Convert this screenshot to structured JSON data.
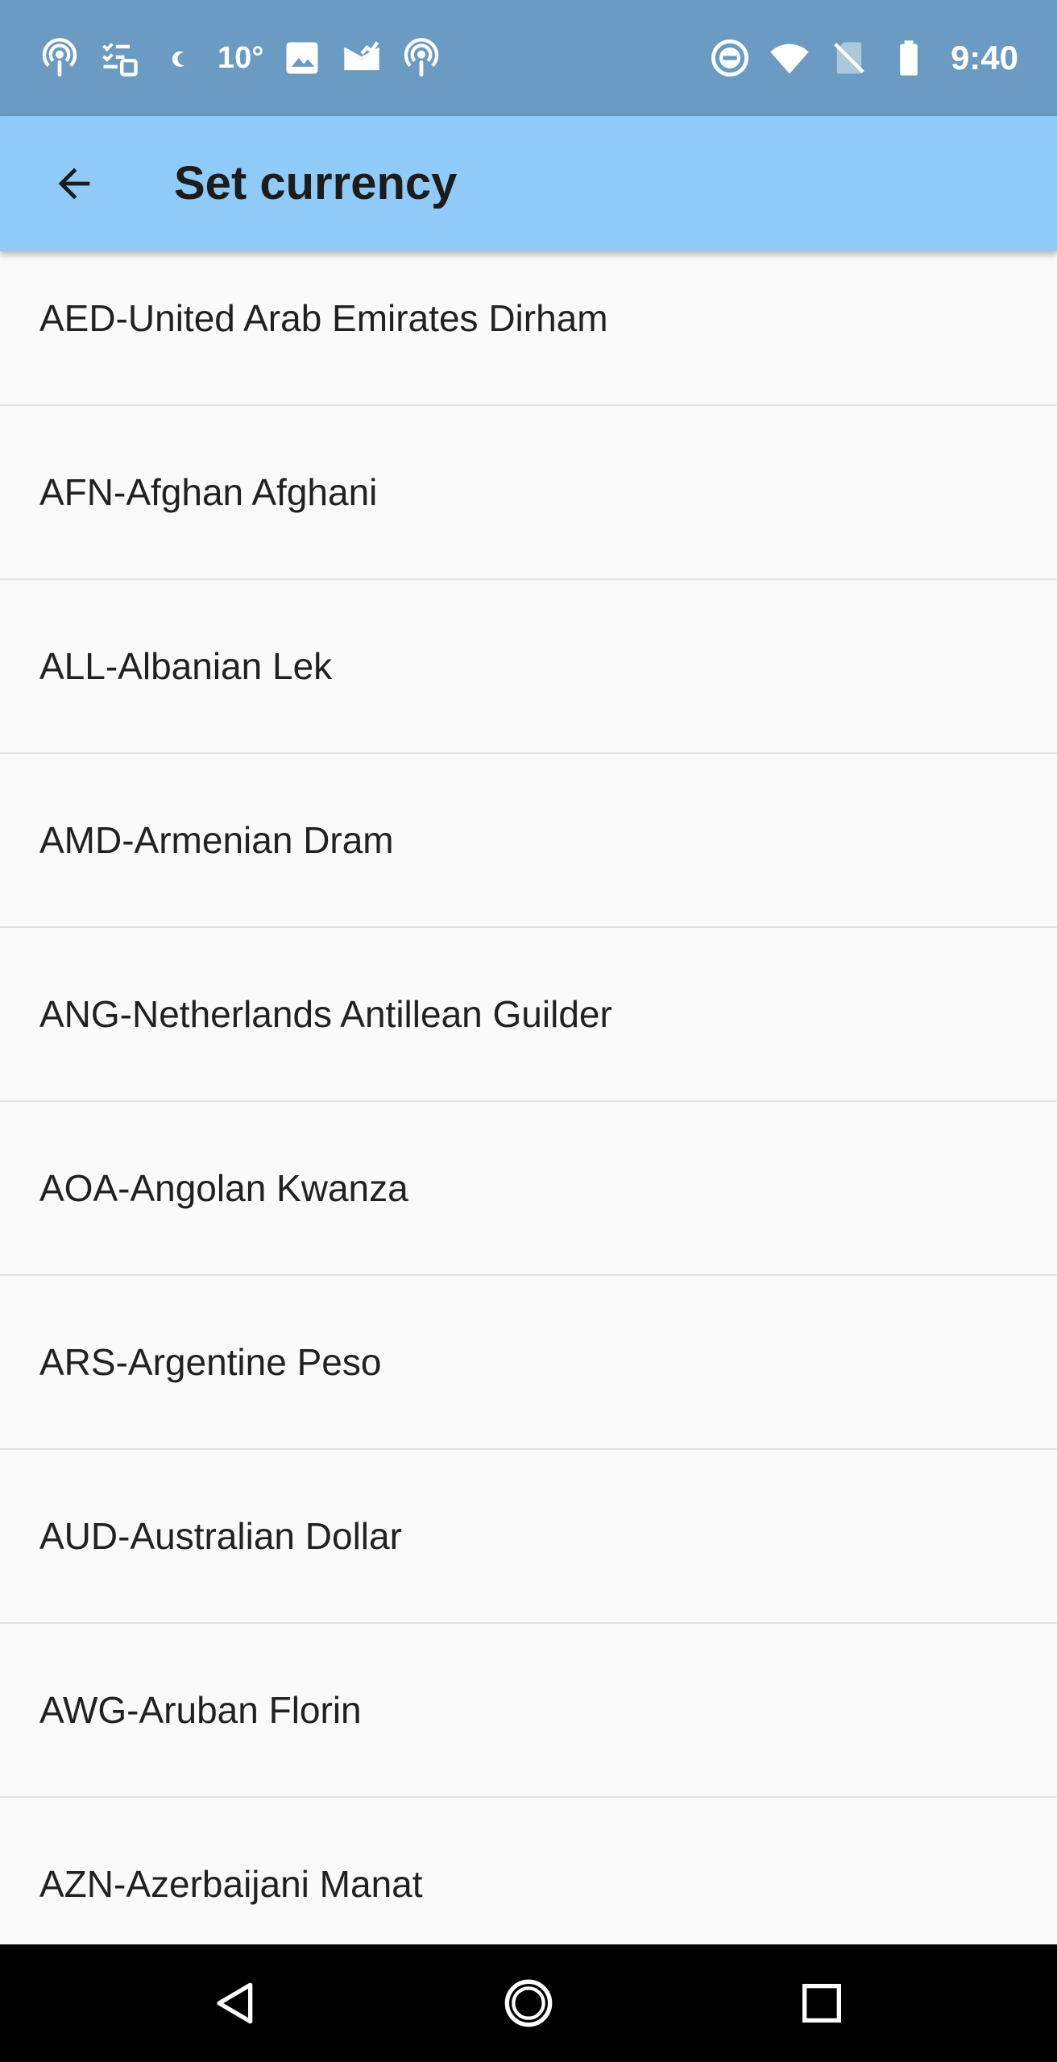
{
  "status_bar": {
    "temperature": "10°",
    "time": "9:40",
    "icons_left": [
      "podcast-icon",
      "tasks-icon",
      "moon-icon",
      "temperature",
      "image-icon",
      "mail-done-icon",
      "podcast-icon"
    ],
    "icons_right": [
      "dnd-icon",
      "wifi-icon",
      "no-sim-icon",
      "battery-icon"
    ],
    "background": "#6b9bc2"
  },
  "app_bar": {
    "title": "Set currency",
    "back_icon": "arrow-back-icon",
    "background": "#90caf9"
  },
  "currencies": [
    "AED-United Arab Emirates Dirham",
    "AFN-Afghan Afghani",
    "ALL-Albanian Lek",
    "AMD-Armenian Dram",
    "ANG-Netherlands Antillean Guilder",
    "AOA-Angolan Kwanza",
    "ARS-Argentine Peso",
    "AUD-Australian Dollar",
    "AWG-Aruban Florin",
    "AZN-Azerbaijani Manat"
  ],
  "nav_bar": {
    "buttons": [
      "back-triangle-icon",
      "home-circle-icon",
      "recents-square-icon"
    ]
  }
}
